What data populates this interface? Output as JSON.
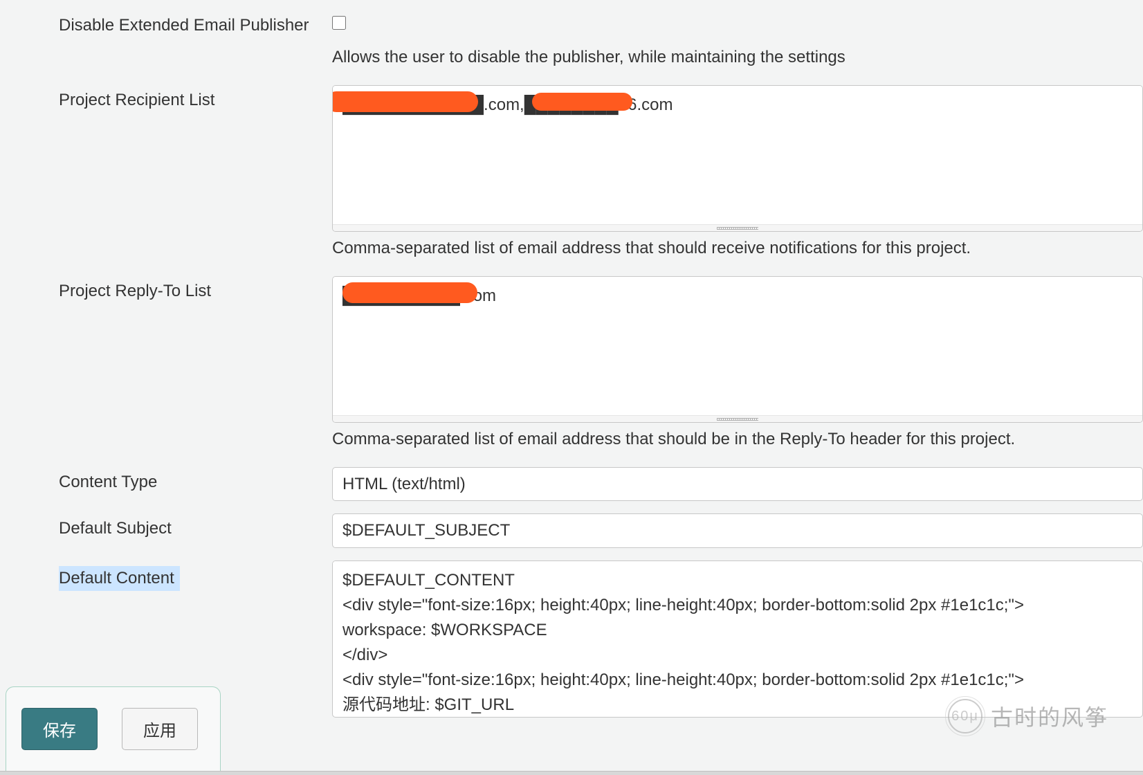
{
  "fields": {
    "disable_publisher": {
      "label": "Disable Extended Email Publisher",
      "checked": false,
      "description": "Allows the user to disable the publisher, while maintaining the settings"
    },
    "recipient_list": {
      "label": "Project Recipient List",
      "value": "████████████.com,████████26.com",
      "description": "Comma-separated list of email address that should receive notifications for this project."
    },
    "reply_to_list": {
      "label": "Project Reply-To List",
      "value": "██████████.com",
      "description": "Comma-separated list of email address that should be in the Reply-To header for this project."
    },
    "content_type": {
      "label": "Content Type",
      "value": "HTML (text/html)"
    },
    "default_subject": {
      "label": "Default Subject",
      "value": "$DEFAULT_SUBJECT"
    },
    "default_content": {
      "label": "Default Content",
      "value": "$DEFAULT_CONTENT\n<div style=\"font-size:16px; height:40px; line-height:40px; border-bottom:solid 2px #1e1c1c;\">\nworkspace: $WORKSPACE\n</div>\n<div style=\"font-size:16px; height:40px; line-height:40px; border-bottom:solid 2px #1e1c1c;\">\n源代码地址: $GIT_URL"
    }
  },
  "buttons": {
    "save": "保存",
    "apply": "应用"
  },
  "watermark": {
    "text": "古时的风筝",
    "icon_text": "60μ"
  }
}
